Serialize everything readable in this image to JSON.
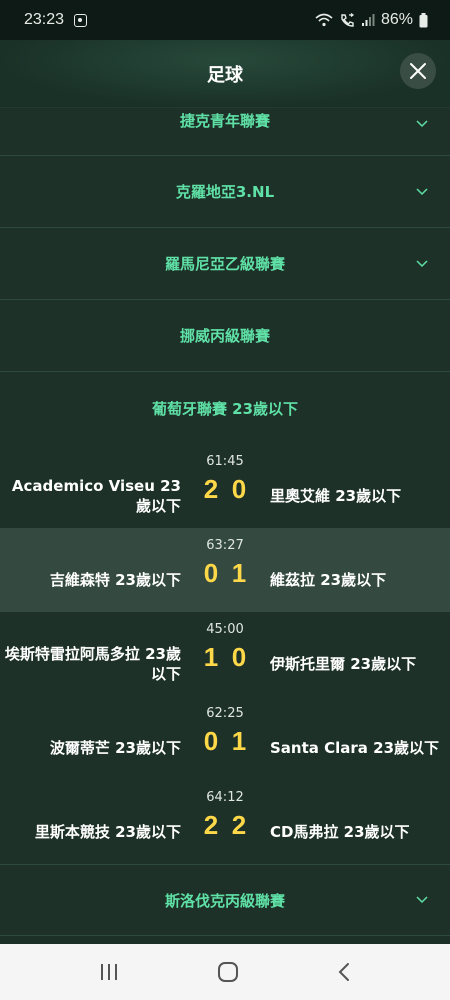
{
  "status_bar": {
    "time": "23:23",
    "battery": "86%"
  },
  "header": {
    "title": "足球"
  },
  "leagues_top": [
    {
      "label": "捷克青年聯賽"
    },
    {
      "label": "克羅地亞3.NL"
    },
    {
      "label": "羅馬尼亞乙級聯賽"
    },
    {
      "label": "挪威丙級聯賽"
    }
  ],
  "section": {
    "title": "葡萄牙聯賽 23歲以下"
  },
  "matches": [
    {
      "clock": "61:45",
      "home": "Academico Viseu 23歲以下",
      "home_score": "2",
      "away_score": "0",
      "away": "里奧艾維 23歲以下"
    },
    {
      "clock": "63:27",
      "home": "吉維森特 23歲以下",
      "home_score": "0",
      "away_score": "1",
      "away": "維茲拉 23歲以下"
    },
    {
      "clock": "45:00",
      "home": "埃斯特雷拉阿馬多拉 23歲以下",
      "home_score": "1",
      "away_score": "0",
      "away": "伊斯托里爾 23歲以下"
    },
    {
      "clock": "62:25",
      "home": "波爾蒂芒 23歲以下",
      "home_score": "0",
      "away_score": "1",
      "away": "Santa Clara 23歲以下"
    },
    {
      "clock": "64:12",
      "home": "里斯本競技 23歲以下",
      "home_score": "2",
      "away_score": "2",
      "away": "CD馬弗拉 23歲以下"
    }
  ],
  "leagues_bottom": [
    {
      "label": "斯洛伐克丙級聯賽"
    }
  ],
  "colors": {
    "accent": "#5fe0a6",
    "score": "#ffd84a",
    "background": "#1d3128",
    "highlight": "#344a40"
  },
  "icons": [
    "wifi-icon",
    "call-icon",
    "signal-icon",
    "battery-icon",
    "close-icon",
    "chevron-down-icon",
    "recent-apps-icon",
    "home-icon",
    "back-icon"
  ]
}
